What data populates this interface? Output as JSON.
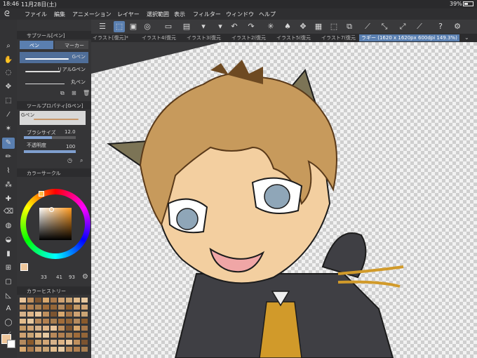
{
  "status_bar": {
    "time": "18:46",
    "date": "11月28日(土)",
    "battery": "39%"
  },
  "menu": [
    "ファイル",
    "編集",
    "アニメーション",
    "レイヤー",
    "選択範囲",
    "表示",
    "フィルター",
    "ウィンドウ",
    "ヘルプ"
  ],
  "subtool_panel": {
    "title": "サブツール[ペン]",
    "tabs": [
      "ペン",
      "マーカー"
    ],
    "brushes": [
      "Gペン",
      "リアルGペン",
      "丸ペン"
    ]
  },
  "tool_property": {
    "title": "ツールプロパティ[Gペン]",
    "brush_name": "Gペン",
    "size_label": "ブラシサイズ",
    "size_value": "12.0",
    "opacity_label": "不透明度",
    "opacity_value": "100"
  },
  "color_circle": {
    "title": "カラーサークル",
    "h": "33",
    "s": "41",
    "v": "93",
    "current_color": "#eec69b"
  },
  "color_history": {
    "title": "カラーヒストリー"
  },
  "document_tabs": [
    "イラスト[復元]*",
    "イラスト4(復元",
    "イラスト3(復元",
    "イラスト2(復元",
    "イラスト5(復元",
    "イラスト7(復元",
    "ラギー (1620 x 1620px 600dpi 149.3%)"
  ],
  "colors": {
    "accent": "#5a7fb0",
    "hair": "#c79a5c",
    "skin": "#f3cfa0",
    "jacket": "#3f3f44",
    "vest": "#d19a2a",
    "eye": "#8fa6b8"
  }
}
